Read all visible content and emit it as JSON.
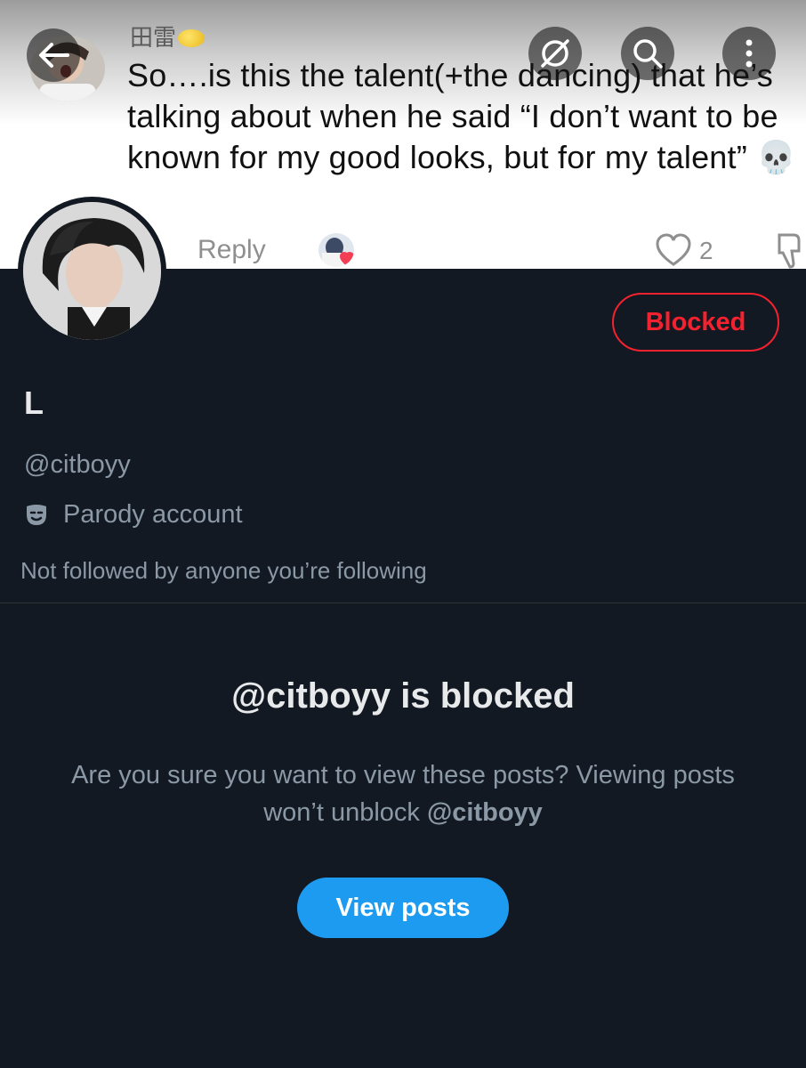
{
  "comment": {
    "author": "田雷",
    "text": "So….is this the talent(+the dancing) that he’s talking about when he said “I don’t want to be known for my good looks, but for my talent” 💀",
    "reply_label": "Reply",
    "like_count": "2"
  },
  "toolbar": {
    "back_icon": "arrow-left-icon",
    "grok_icon": "grok-icon",
    "search_icon": "search-icon",
    "more_icon": "more-vertical-icon"
  },
  "profile": {
    "name": "L",
    "handle": "@citboyy",
    "label": "Parody account",
    "label_icon": "mask-icon",
    "followers_note": "Not followed by anyone you’re following",
    "blocked_button": "Blocked"
  },
  "blocked": {
    "title": "@citboyy is blocked",
    "desc_prefix": "Are you sure you want to view these posts? Viewing posts won’t unblock ",
    "desc_handle": "@citboyy",
    "view_button": "View posts"
  },
  "colors": {
    "background": "#131922",
    "accent": "#1d9bf0",
    "blocked_red": "#f4212e",
    "muted_text": "#8b98a5"
  }
}
